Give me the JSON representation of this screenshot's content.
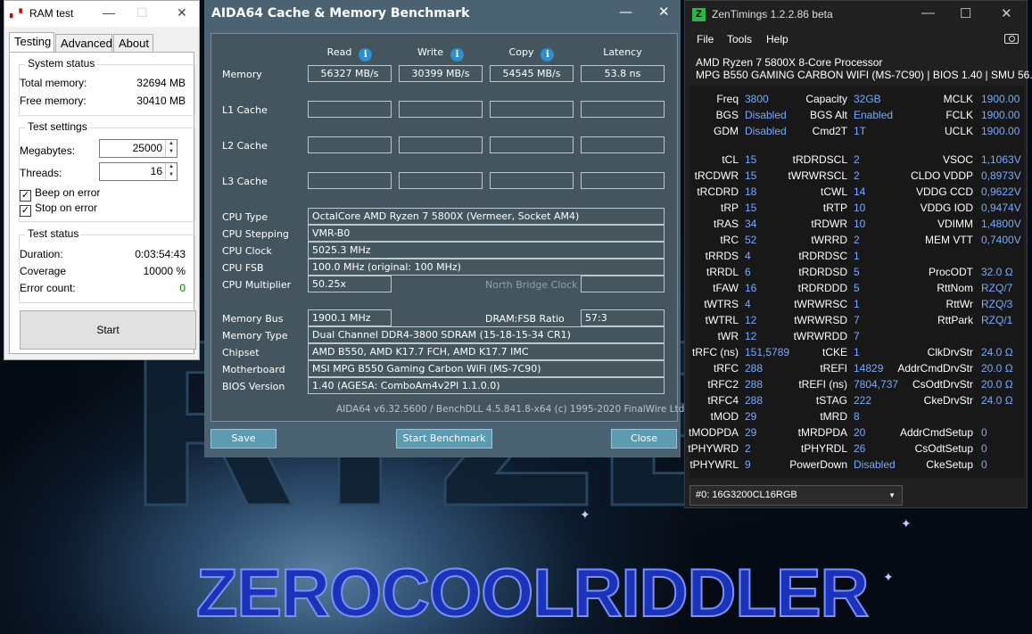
{
  "ramtest": {
    "title": "RAM test",
    "tabs": [
      "Testing",
      "Advanced",
      "About"
    ],
    "system_status": {
      "label": "System status",
      "total_label": "Total memory:",
      "total_value": "32694 MB",
      "free_label": "Free memory:",
      "free_value": "30410 MB"
    },
    "test_settings": {
      "label": "Test settings",
      "megabytes_label": "Megabytes:",
      "megabytes_value": "25000",
      "threads_label": "Threads:",
      "threads_value": "16",
      "beep_label": "Beep on error",
      "beep_checked": true,
      "stop_label": "Stop on error",
      "stop_checked": true
    },
    "test_status": {
      "label": "Test status",
      "duration_label": "Duration:",
      "duration_value": "0:03:54:43",
      "coverage_label": "Coverage",
      "coverage_value": "10000 %",
      "errors_label": "Error count:",
      "errors_value": "0"
    },
    "start_label": "Start"
  },
  "aida": {
    "title": "AIDA64 Cache & Memory Benchmark",
    "columns": [
      "Read",
      "Write",
      "Copy",
      "Latency"
    ],
    "rows": [
      {
        "label": "Memory",
        "values": [
          "56327 MB/s",
          "30399 MB/s",
          "54545 MB/s",
          "53.8 ns"
        ]
      },
      {
        "label": "L1 Cache",
        "values": [
          "",
          "",
          "",
          ""
        ]
      },
      {
        "label": "L2 Cache",
        "values": [
          "",
          "",
          "",
          ""
        ]
      },
      {
        "label": "L3 Cache",
        "values": [
          "",
          "",
          "",
          ""
        ]
      }
    ],
    "cpu_type_label": "CPU Type",
    "cpu_type": "OctalCore AMD Ryzen 7 5800X  (Vermeer, Socket AM4)",
    "cpu_stepping_label": "CPU Stepping",
    "cpu_stepping": "VMR-B0",
    "cpu_clock_label": "CPU Clock",
    "cpu_clock": "5025.3 MHz",
    "cpu_fsb_label": "CPU FSB",
    "cpu_fsb": "100.0 MHz  (original: 100 MHz)",
    "cpu_mult_label": "CPU Multiplier",
    "cpu_mult": "50.25x",
    "nb_clock_label": "North Bridge Clock",
    "nb_clock": "",
    "mem_bus_label": "Memory Bus",
    "mem_bus": "1900.1 MHz",
    "dram_ratio_label": "DRAM:FSB Ratio",
    "dram_ratio": "57:3",
    "mem_type_label": "Memory Type",
    "mem_type": "Dual Channel DDR4-3800 SDRAM  (15-18-15-34 CR1)",
    "chipset_label": "Chipset",
    "chipset": "AMD B550, AMD K17.7 FCH, AMD K17.7 IMC",
    "mobo_label": "Motherboard",
    "mobo": "MSI MPG B550 Gaming Carbon WiFi (MS-7C90)",
    "bios_label": "BIOS Version",
    "bios": "1.40  (AGESA: ComboAm4v2PI 1.1.0.0)",
    "footer": "AIDA64 v6.32.5600 / BenchDLL 4.5.841.8-x64  (c) 1995-2020 FinalWire Ltd.",
    "save_label": "Save",
    "start_label": "Start Benchmark",
    "close_label": "Close"
  },
  "zen": {
    "title": "ZenTimings 1.2.2.86 beta",
    "menu": [
      "File",
      "Tools",
      "Help"
    ],
    "cpu_name": "AMD Ryzen 7 5800X 8-Core Processor",
    "board": "MPG B550 GAMING CARBON WIFI (MS-7C90) | BIOS 1.40 | SMU 56.34.00",
    "rows": [
      [
        [
          "Freq",
          "3800"
        ],
        [
          "Capacity",
          "32GB"
        ],
        [
          "MCLK",
          "1900.00"
        ]
      ],
      [
        [
          "BGS",
          "Disabled"
        ],
        [
          "BGS Alt",
          "Enabled"
        ],
        [
          "FCLK",
          "1900.00"
        ]
      ],
      [
        [
          "GDM",
          "Disabled"
        ],
        [
          "Cmd2T",
          "1T"
        ],
        [
          "UCLK",
          "1900.00"
        ]
      ],
      null,
      [
        [
          "tCL",
          "15"
        ],
        [
          "tRDRDSCL",
          "2"
        ],
        [
          "VSOC",
          "1,1063V"
        ]
      ],
      [
        [
          "tRCDWR",
          "15"
        ],
        [
          "tWRWRSCL",
          "2"
        ],
        [
          "CLDO VDDP",
          "0,8973V"
        ]
      ],
      [
        [
          "tRCDRD",
          "18"
        ],
        [
          "tCWL",
          "14"
        ],
        [
          "VDDG CCD",
          "0,9622V"
        ]
      ],
      [
        [
          "tRP",
          "15"
        ],
        [
          "tRTP",
          "10"
        ],
        [
          "VDDG IOD",
          "0,9474V"
        ]
      ],
      [
        [
          "tRAS",
          "34"
        ],
        [
          "tRDWR",
          "10"
        ],
        [
          "VDIMM",
          "1,4800V"
        ]
      ],
      [
        [
          "tRC",
          "52"
        ],
        [
          "tWRRD",
          "2"
        ],
        [
          "MEM VTT",
          "0,7400V"
        ]
      ],
      [
        [
          "tRRDS",
          "4"
        ],
        [
          "tRDRDSC",
          "1"
        ],
        [
          "",
          ""
        ]
      ],
      [
        [
          "tRRDL",
          "6"
        ],
        [
          "tRDRDSD",
          "5"
        ],
        [
          "ProcODT",
          "32.0 Ω"
        ]
      ],
      [
        [
          "tFAW",
          "16"
        ],
        [
          "tRDRDDD",
          "5"
        ],
        [
          "RttNom",
          "RZQ/7"
        ]
      ],
      [
        [
          "tWTRS",
          "4"
        ],
        [
          "tWRWRSC",
          "1"
        ],
        [
          "RttWr",
          "RZQ/3"
        ]
      ],
      [
        [
          "tWTRL",
          "12"
        ],
        [
          "tWRWRSD",
          "7"
        ],
        [
          "RttPark",
          "RZQ/1"
        ]
      ],
      [
        [
          "tWR",
          "12"
        ],
        [
          "tWRWRDD",
          "7"
        ],
        [
          "",
          ""
        ]
      ],
      [
        [
          "tRFC (ns)",
          "151,5789"
        ],
        [
          "tCKE",
          "1"
        ],
        [
          "ClkDrvStr",
          "24.0 Ω"
        ]
      ],
      [
        [
          "tRFC",
          "288"
        ],
        [
          "tREFI",
          "14829"
        ],
        [
          "AddrCmdDrvStr",
          "20.0 Ω"
        ]
      ],
      [
        [
          "tRFC2",
          "288"
        ],
        [
          "tREFI (ns)",
          "7804,737"
        ],
        [
          "CsOdtDrvStr",
          "20.0 Ω"
        ]
      ],
      [
        [
          "tRFC4",
          "288"
        ],
        [
          "tSTAG",
          "222"
        ],
        [
          "CkeDrvStr",
          "24.0 Ω"
        ]
      ],
      [
        [
          "tMOD",
          "29"
        ],
        [
          "tMRD",
          "8"
        ],
        [
          "",
          ""
        ]
      ],
      [
        [
          "tMODPDA",
          "29"
        ],
        [
          "tMRDPDA",
          "20"
        ],
        [
          "AddrCmdSetup",
          "0"
        ]
      ],
      [
        [
          "tPHYWRD",
          "2"
        ],
        [
          "tPHYRDL",
          "26"
        ],
        [
          "CsOdtSetup",
          "0"
        ]
      ],
      [
        [
          "tPHYWRL",
          "9"
        ],
        [
          "PowerDown",
          "Disabled"
        ],
        [
          "CkeSetup",
          "0"
        ]
      ]
    ],
    "profile": "#0: 16G3200CL16RGB"
  },
  "wallpaper": {
    "text": "RYZEN",
    "brand": "ZEROCOOLRIDDLER"
  },
  "colors": {
    "zen_value": "#78aaff",
    "aida_bg": "#4a6272",
    "ok_green": "#008000"
  }
}
